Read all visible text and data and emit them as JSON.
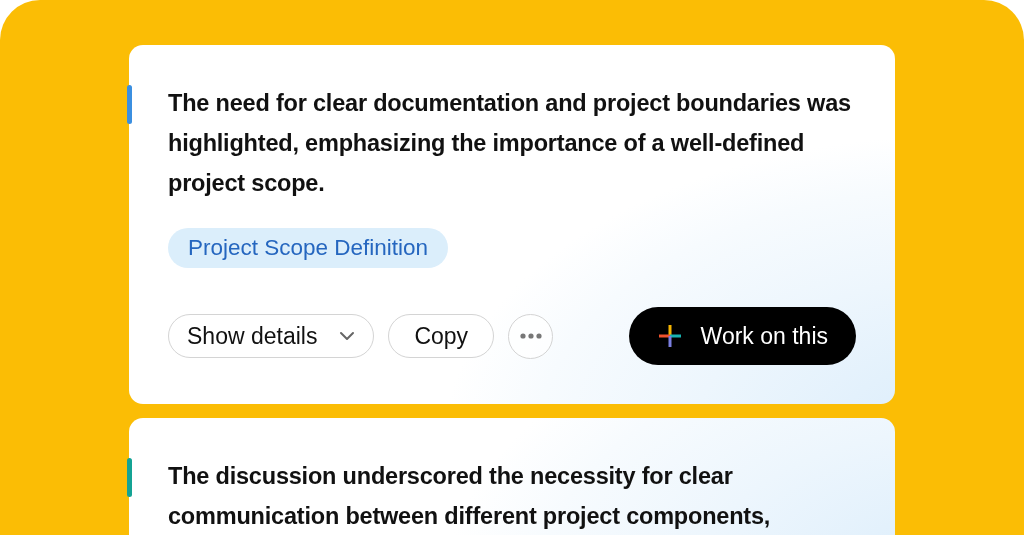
{
  "cards": [
    {
      "color": "#3b8fe0",
      "text": "The need for clear documentation and project boundaries was highlighted, emphasizing the importance of a well-defined project scope.",
      "tag": "Project Scope Definition",
      "details_button": "Show details",
      "copy_button": "Copy",
      "action_button": "Work on this"
    },
    {
      "color": "#14a394",
      "text": "The discussion underscored the necessity for clear communication between different project components,"
    }
  ]
}
